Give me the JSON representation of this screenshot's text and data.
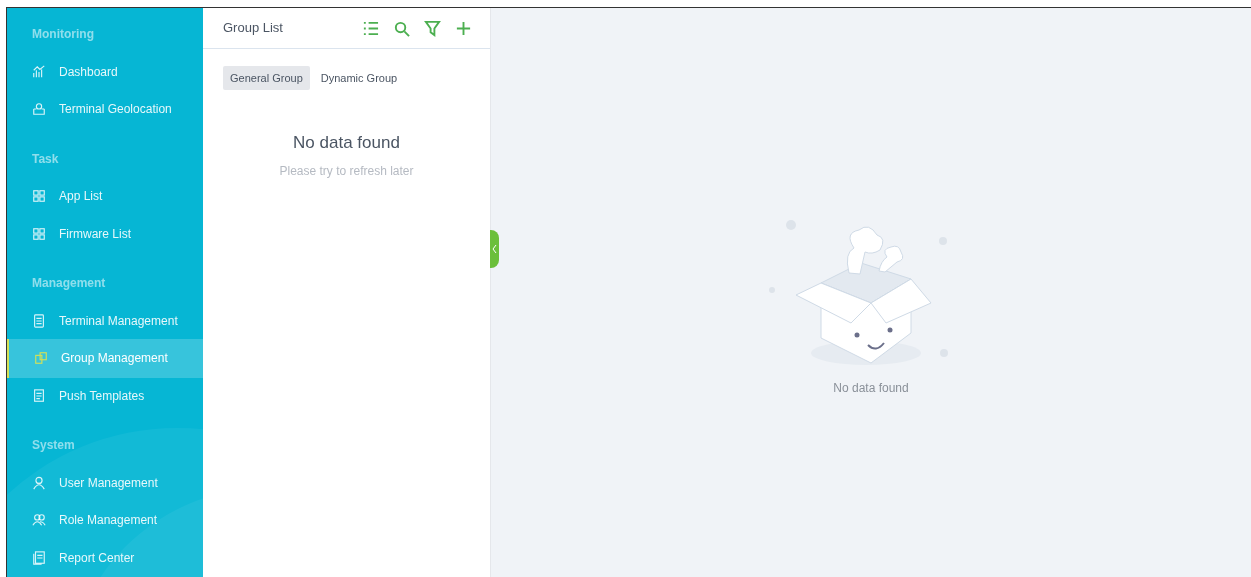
{
  "sidebar": {
    "sections": [
      {
        "title": "Monitoring",
        "items": [
          {
            "label": "Dashboard",
            "kind": "chart",
            "selected": false
          },
          {
            "label": "Terminal Geolocation",
            "kind": "map",
            "selected": false
          }
        ]
      },
      {
        "title": "Task",
        "items": [
          {
            "label": "App List",
            "kind": "grid",
            "selected": false
          },
          {
            "label": "Firmware List",
            "kind": "grid",
            "selected": false
          }
        ]
      },
      {
        "title": "Management",
        "items": [
          {
            "label": "Terminal Management",
            "kind": "device",
            "selected": false
          },
          {
            "label": "Group Management",
            "kind": "squares",
            "selected": true
          },
          {
            "label": "Push Templates",
            "kind": "doc",
            "selected": false
          }
        ]
      },
      {
        "title": "System",
        "items": [
          {
            "label": "User Management",
            "kind": "user",
            "selected": false
          },
          {
            "label": "Role Management",
            "kind": "users",
            "selected": false
          },
          {
            "label": "Report Center",
            "kind": "report",
            "selected": false
          }
        ]
      }
    ]
  },
  "group_panel": {
    "title": "Group List",
    "toolbar": [
      {
        "kind": "list"
      },
      {
        "kind": "search"
      },
      {
        "kind": "filter"
      },
      {
        "kind": "add"
      }
    ],
    "tabs": [
      {
        "label": "General Group",
        "selected": true
      },
      {
        "label": "Dynamic Group",
        "selected": false
      }
    ],
    "empty_title": "No data found",
    "empty_hint": "Please try to refresh later"
  },
  "detail": {
    "empty_text": "No data found"
  }
}
